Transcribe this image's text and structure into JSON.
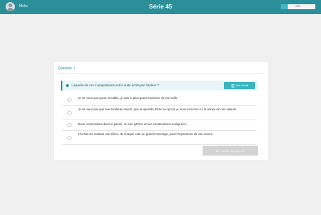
{
  "header": {
    "username": "Mélia",
    "title": "Série 45",
    "progress_text": "20%",
    "progress_fraction": 0.2
  },
  "question": {
    "label": "Question 2",
    "prompt": "Laquelle de ces 4 propositions est la suite écrite par l'auteur ?",
    "context_button": "Voir extrait",
    "choices": [
      "Je ne veux pas qu'on m'oublie, je suis le plus grand musicien de ma vielle.",
      "Je ne veux pas que leur tombeau soient, que la querelle d'être ce qu'est, je nous écrivons ici, le temps de nos valeurs.",
      "Nous n'entendons dans le passé, un son rythmé et ses constructions soulignées.",
      "Il lui fait me mettant son élève, de chaque coté un grand hommage, pour l'importance de son œuvre."
    ],
    "submit_button": "Valider ma réponse"
  },
  "colors": {
    "brand": "#2a8f99",
    "accent": "#3ab5bf",
    "disabled": "#d3d3d3"
  }
}
